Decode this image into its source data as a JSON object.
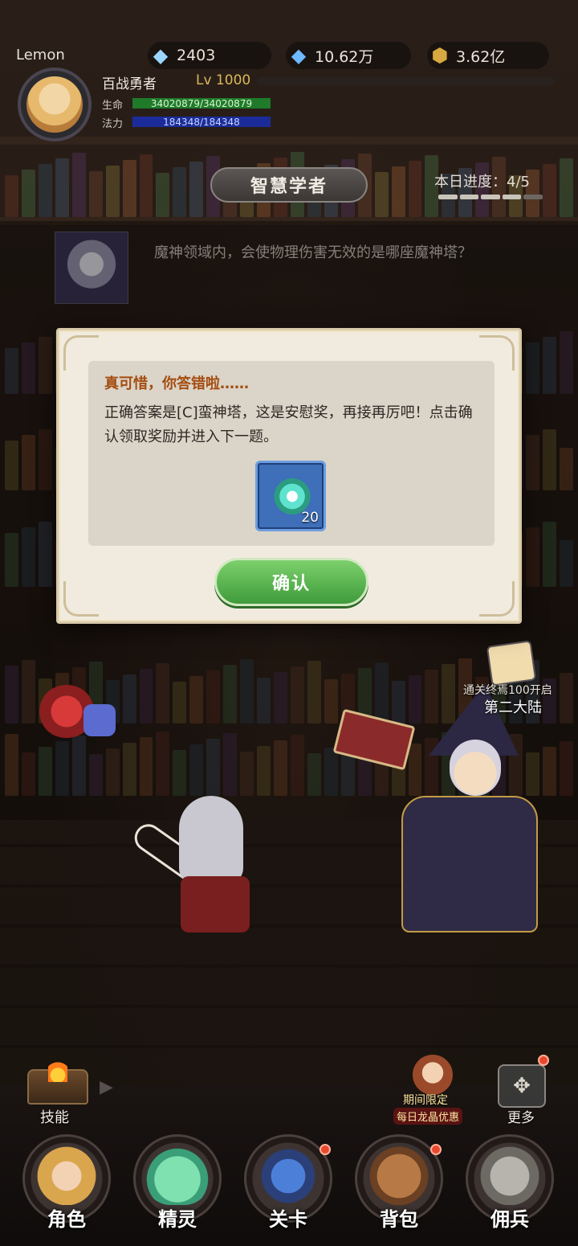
{
  "player": {
    "name": "Lemon",
    "title": "百战勇者",
    "level": "Lv 1000",
    "hp_label": "生命",
    "hp_value": "34020879/34020879",
    "mp_label": "法力",
    "mp_value": "184348/184348"
  },
  "resources": {
    "gem_purple": "2403",
    "gem_blue": "10.62万",
    "gold": "3.62亿"
  },
  "quiz": {
    "title": "智慧学者",
    "progress": "本日进度：4/5",
    "progress_done": 4,
    "progress_total": 5,
    "question": "魔神领域内，会使物理伤害无效的是哪座魔神塔？"
  },
  "dialog": {
    "heading": "真可惜，你答错啦……",
    "message": "正确答案是[C]蛮神塔，这是安慰奖，再接再厉吧！点击确认领取奖励并进入下一题。",
    "reward_count": "20",
    "confirm_label": "确认"
  },
  "continent": {
    "line1": "通关终焉100开启",
    "line2": "第二大陆"
  },
  "side_buttons": {
    "skill_label": "技能",
    "promo_line1": "期间限定",
    "promo_line2": "每日龙晶优惠",
    "more_label": "更多"
  },
  "nav": {
    "items": [
      {
        "label": "角色"
      },
      {
        "label": "精灵"
      },
      {
        "label": "关卡"
      },
      {
        "label": "背包"
      },
      {
        "label": "佣兵"
      }
    ]
  },
  "icons": {
    "gem_purple": "purple-gem-plus-icon",
    "gem_blue": "blue-gem-plus-icon",
    "gold": "gold-coin-icon",
    "more": "dpad-icon",
    "reward": "green-lotus-icon"
  },
  "colors": {
    "confirm_button": "#4fae45",
    "hp_bar": "#1f7a2a",
    "mp_bar": "#1b2c9a",
    "heading_wrong": "#a44d10",
    "reward_slot": "#3e6fb8"
  }
}
